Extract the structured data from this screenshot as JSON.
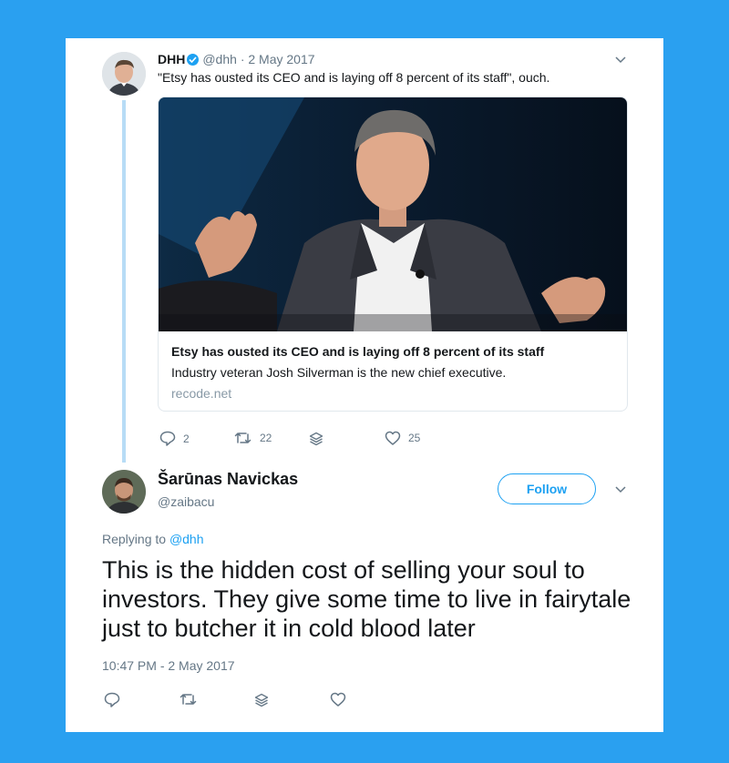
{
  "parent_tweet": {
    "author_name": "DHH",
    "author_handle": "@dhh",
    "date": "· 2 May 2017",
    "text": "\"Etsy has ousted its CEO and is laying off 8 percent of its staff\", ouch.",
    "link_card": {
      "title": "Etsy has ousted its CEO and is laying off 8 percent of its staff",
      "description": "Industry veteran Josh Silverman is the new chief executive.",
      "domain": "recode.net"
    },
    "actions": {
      "reply_count": "2",
      "retweet_count": "22",
      "like_count": "25"
    }
  },
  "reply_tweet": {
    "author_name": "Šarūnas Navickas",
    "author_handle": "@zaibacu",
    "follow_label": "Follow",
    "replying_prefix": "Replying to",
    "replying_to": "@dhh",
    "text": "This is the hidden cost of selling your soul to investors. They give some time to live in fairytale just to butcher it in cold blood later",
    "timestamp": "10:47 PM - 2 May 2017"
  },
  "colors": {
    "background": "#2aa0f0",
    "accent": "#1da1f2",
    "thread_line": "#b7dcf6",
    "muted_text": "#657786"
  },
  "icons": [
    "verified-icon",
    "chevron-down-icon",
    "reply-icon",
    "retweet-icon",
    "stack-icon",
    "heart-icon"
  ]
}
